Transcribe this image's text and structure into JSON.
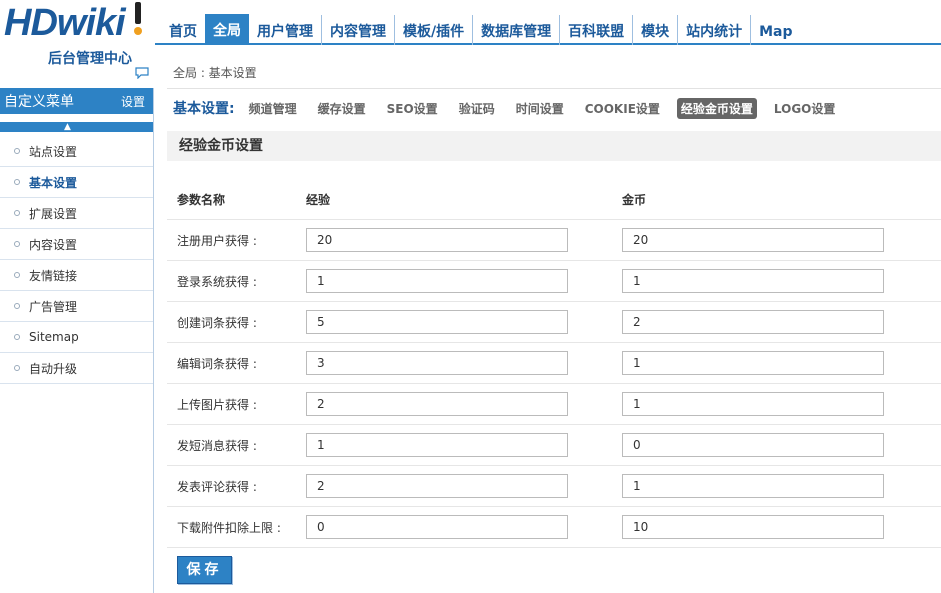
{
  "logo": {
    "text": "HDwiki",
    "subtitle": "后台管理中心"
  },
  "topnav": {
    "items": [
      "首页",
      "全局",
      "用户管理",
      "内容管理",
      "模板/插件",
      "数据库管理",
      "百科联盟",
      "模块",
      "站内统计",
      "Map"
    ],
    "active_index": 1
  },
  "sidebar": {
    "header": "自定义菜单",
    "settings": "设置",
    "items": [
      "站点设置",
      "基本设置",
      "扩展设置",
      "内容设置",
      "友情链接",
      "广告管理",
      "Sitemap",
      "自动升级"
    ],
    "active_index": 1
  },
  "breadcrumb": "全局 : 基本设置",
  "subnav": {
    "lead": "基本设置:",
    "items": [
      "频道管理",
      "缓存设置",
      "SEO设置",
      "验证码",
      "时间设置",
      "COOKIE设置",
      "经验金币设置",
      "LOGO设置"
    ],
    "active_index": 6
  },
  "section_title": "经验金币设置",
  "table": {
    "headers": [
      "参数名称",
      "经验",
      "金币"
    ],
    "rows": [
      {
        "name": "注册用户获得 :",
        "exp": "20",
        "gold": "20"
      },
      {
        "name": "登录系统获得 :",
        "exp": "1",
        "gold": "1"
      },
      {
        "name": "创建词条获得 :",
        "exp": "5",
        "gold": "2"
      },
      {
        "name": "编辑词条获得 :",
        "exp": "3",
        "gold": "1"
      },
      {
        "name": "上传图片获得 :",
        "exp": "2",
        "gold": "1"
      },
      {
        "name": "发短消息获得 :",
        "exp": "1",
        "gold": "0"
      },
      {
        "name": "发表评论获得 :",
        "exp": "2",
        "gold": "1"
      },
      {
        "name": "下载附件扣除上限 :",
        "exp": "0",
        "gold": "10"
      }
    ]
  },
  "save_label": "保存",
  "colors": {
    "accent": "#2d82c5",
    "brand": "#1c5a9b"
  }
}
